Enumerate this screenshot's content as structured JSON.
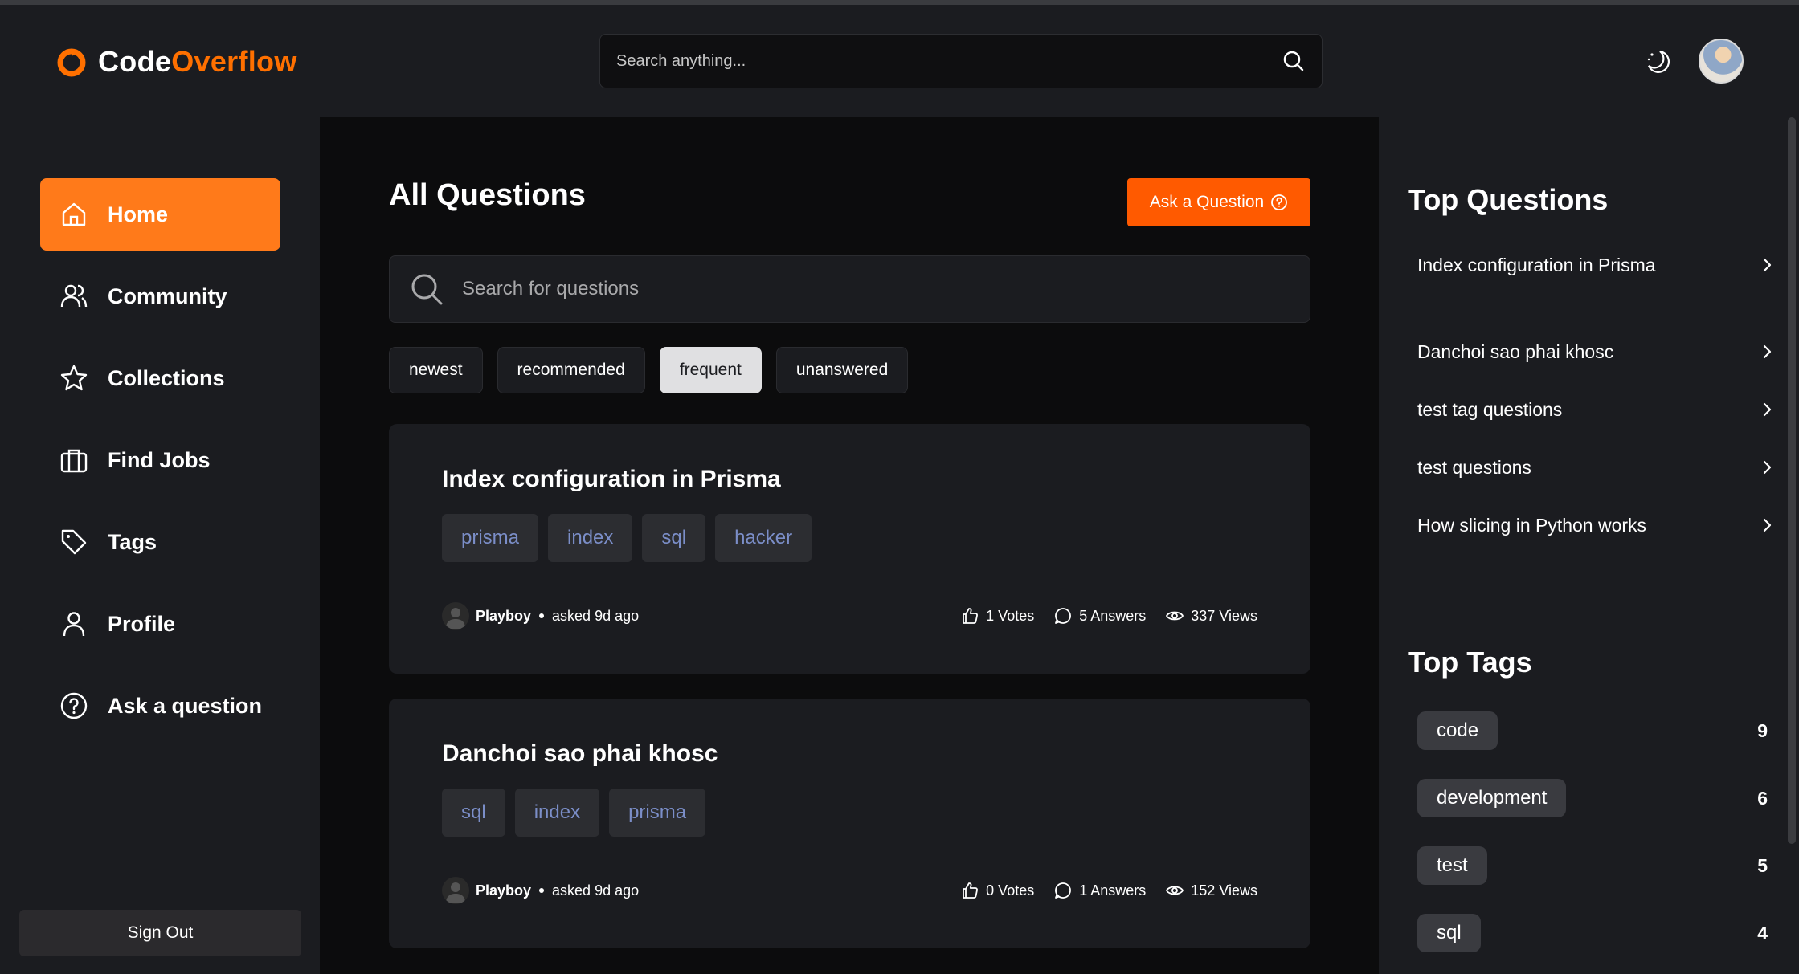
{
  "app": {
    "logo_part1": "Code",
    "logo_part2": "Overflow",
    "search_placeholder": "Search anything...",
    "accent_color": "#ff7000"
  },
  "sidebar": {
    "items": [
      {
        "label": "Home",
        "icon": "home-icon",
        "active": true
      },
      {
        "label": "Community",
        "icon": "users-icon"
      },
      {
        "label": "Collections",
        "icon": "star-icon"
      },
      {
        "label": "Find Jobs",
        "icon": "briefcase-icon"
      },
      {
        "label": "Tags",
        "icon": "tag-icon"
      },
      {
        "label": "Profile",
        "icon": "user-icon"
      },
      {
        "label": "Ask a question",
        "icon": "question-circle-icon"
      }
    ],
    "sign_out": "Sign Out"
  },
  "main": {
    "title": "All Questions",
    "ask_button": "Ask a Question",
    "search_placeholder": "Search for questions",
    "filters": [
      "newest",
      "recommended",
      "frequent",
      "unanswered"
    ],
    "active_filter": "frequent",
    "questions": [
      {
        "title": "Index configuration in Prisma",
        "tags": [
          "prisma",
          "index",
          "sql",
          "hacker"
        ],
        "author": "Playboy",
        "asked": "asked 9d ago",
        "votes": "1 Votes",
        "answers": "5 Answers",
        "views": "337 Views"
      },
      {
        "title": "Danchoi sao phai khosc",
        "tags": [
          "sql",
          "index",
          "prisma"
        ],
        "author": "Playboy",
        "asked": "asked 9d ago",
        "votes": "0 Votes",
        "answers": "1 Answers",
        "views": "152 Views"
      }
    ]
  },
  "right": {
    "top_questions_title": "Top Questions",
    "top_questions": [
      "Index configuration in Prisma",
      "Danchoi sao phai khosc",
      "test tag questions",
      "test questions",
      "How slicing in Python works"
    ],
    "top_tags_title": "Top Tags",
    "top_tags": [
      {
        "name": "code",
        "count": "9"
      },
      {
        "name": "development",
        "count": "6"
      },
      {
        "name": "test",
        "count": "5"
      },
      {
        "name": "sql",
        "count": "4"
      }
    ]
  }
}
